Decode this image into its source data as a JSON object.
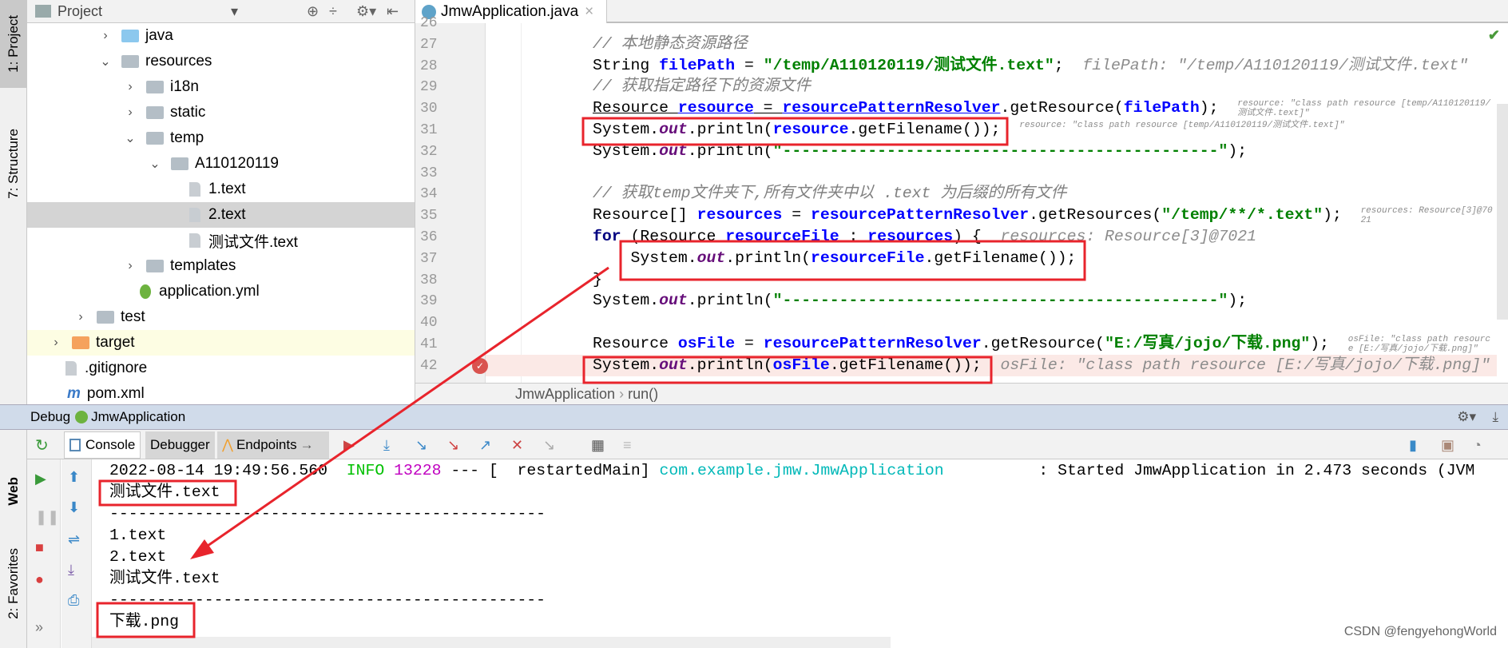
{
  "sidebar_tabs": {
    "project": "1: Project",
    "structure": "7: Structure",
    "web": "Web",
    "favorites": "2: Favorites"
  },
  "project": {
    "title": "Project",
    "tree": [
      {
        "label": "java",
        "depth": 2,
        "icon": "folder-blue",
        "arrow": "right"
      },
      {
        "label": "resources",
        "depth": 2,
        "icon": "resources-folder",
        "arrow": "down"
      },
      {
        "label": "i18n",
        "depth": 3,
        "icon": "folder",
        "arrow": "right"
      },
      {
        "label": "static",
        "depth": 3,
        "icon": "folder",
        "arrow": "right"
      },
      {
        "label": "temp",
        "depth": 3,
        "icon": "folder",
        "arrow": "down"
      },
      {
        "label": "A110120119",
        "depth": 4,
        "icon": "folder",
        "arrow": "down"
      },
      {
        "label": "1.text",
        "depth": 5,
        "icon": "file"
      },
      {
        "label": "2.text",
        "depth": 5,
        "icon": "file",
        "selected": true
      },
      {
        "label": "测试文件.text",
        "depth": 5,
        "icon": "file"
      },
      {
        "label": "templates",
        "depth": 3,
        "icon": "folder",
        "arrow": "right"
      },
      {
        "label": "application.yml",
        "depth": 3,
        "icon": "spring-yml"
      },
      {
        "label": "test",
        "depth": 1,
        "icon": "folder",
        "arrow": "right"
      },
      {
        "label": "target",
        "depth": 0,
        "icon": "folder-orange",
        "arrow": "right",
        "highlight": true
      },
      {
        "label": ".gitignore",
        "depth": 0,
        "icon": "file"
      },
      {
        "label": "pom.xml",
        "depth": 0,
        "icon": "maven"
      }
    ]
  },
  "editor": {
    "tab": "JmwApplication.java",
    "breadcrumb": [
      "JmwApplication",
      "run()"
    ],
    "lines": [
      {
        "n": "26",
        "t": []
      },
      {
        "n": "27",
        "t": [
          [
            "cm",
            "// 本地静态资源路径"
          ]
        ]
      },
      {
        "n": "28",
        "t": [
          [
            "pl",
            "String "
          ],
          [
            "var",
            "filePath"
          ],
          [
            "pl",
            " = "
          ],
          [
            "str",
            "\"/temp/A110120119/测试文件.text\""
          ],
          [
            "pl",
            ";  "
          ],
          [
            "hint",
            "filePath: \"/temp/A110120119/测试文件.text\""
          ]
        ]
      },
      {
        "n": "29",
        "t": [
          [
            "cm",
            "// 获取指定路径下的资源文件"
          ]
        ]
      },
      {
        "n": "30",
        "t": [
          [
            "pl ul",
            "Resource "
          ],
          [
            "var ul",
            "resource"
          ],
          [
            "pl ul",
            " = "
          ],
          [
            "var ul",
            "resourcePatternResolver"
          ],
          [
            "pl",
            ".getResource("
          ],
          [
            "var",
            "filePath"
          ],
          [
            "pl",
            ");  "
          ],
          [
            "hint",
            "resource: \"class path resource [temp/A110120119/测试文件.text]\""
          ]
        ]
      },
      {
        "n": "31",
        "t": [
          [
            "pl",
            "System."
          ],
          [
            "fld",
            "out"
          ],
          [
            "pl",
            ".println("
          ],
          [
            "var",
            "resource"
          ],
          [
            "pl",
            ".getFilename());  "
          ],
          [
            "hint",
            "resource: \"class path resource [temp/A110120119/测试文件.text]\""
          ]
        ]
      },
      {
        "n": "32",
        "t": [
          [
            "pl",
            "System."
          ],
          [
            "fld",
            "out"
          ],
          [
            "pl",
            ".println("
          ],
          [
            "str",
            "\"----------------------------------------------\""
          ],
          [
            "pl",
            ");"
          ]
        ]
      },
      {
        "n": "33",
        "t": []
      },
      {
        "n": "34",
        "t": [
          [
            "cm",
            "// 获取temp文件夹下,所有文件夹中以 .text 为后缀的所有文件"
          ]
        ]
      },
      {
        "n": "35",
        "t": [
          [
            "pl",
            "Resource[] "
          ],
          [
            "var",
            "resources"
          ],
          [
            "pl",
            " = "
          ],
          [
            "var",
            "resourcePatternResolver"
          ],
          [
            "pl",
            ".getResources("
          ],
          [
            "str",
            "\"/temp/**/*.text\""
          ],
          [
            "pl",
            ");  "
          ],
          [
            "hint",
            "resources: Resource[3]@7021"
          ]
        ]
      },
      {
        "n": "36",
        "t": [
          [
            "kw",
            "for"
          ],
          [
            "pl",
            " (Resource "
          ],
          [
            "var",
            "resourceFile"
          ],
          [
            "pl",
            " : "
          ],
          [
            "var",
            "resources"
          ],
          [
            "pl",
            ") {  "
          ],
          [
            "hint",
            "resources: Resource[3]@7021"
          ]
        ]
      },
      {
        "n": "37",
        "t": [
          [
            "pl",
            "    System."
          ],
          [
            "fld",
            "out"
          ],
          [
            "pl",
            ".println("
          ],
          [
            "var",
            "resourceFile"
          ],
          [
            "pl",
            ".getFilename());"
          ]
        ]
      },
      {
        "n": "38",
        "t": [
          [
            "pl",
            "}"
          ]
        ]
      },
      {
        "n": "39",
        "t": [
          [
            "pl",
            "System."
          ],
          [
            "fld",
            "out"
          ],
          [
            "pl",
            ".println("
          ],
          [
            "str",
            "\"----------------------------------------------\""
          ],
          [
            "pl",
            ");"
          ]
        ]
      },
      {
        "n": "40",
        "t": []
      },
      {
        "n": "41",
        "t": [
          [
            "pl",
            "Resource "
          ],
          [
            "var",
            "osFile"
          ],
          [
            "pl",
            " = "
          ],
          [
            "var",
            "resourcePatternResolver"
          ],
          [
            "pl",
            ".getResource("
          ],
          [
            "str",
            "\"E:/写真/jojo/下载.png\""
          ],
          [
            "pl",
            ");  "
          ],
          [
            "hint",
            "osFile: \"class path resource [E:/写真/jojo/下载.png]\""
          ]
        ]
      },
      {
        "n": "42",
        "t": [
          [
            "pl",
            "System."
          ],
          [
            "fld",
            "out"
          ],
          [
            "pl",
            ".println("
          ],
          [
            "var",
            "osFile"
          ],
          [
            "pl",
            ".getFilename());  "
          ],
          [
            "hint",
            "osFile: \"class path resource [E:/写真/jojo/下载.png]\""
          ]
        ],
        "current": true
      }
    ]
  },
  "debug": {
    "label": "Debug",
    "config": "JmwApplication",
    "tabs": [
      "Console",
      "Debugger",
      "Endpoints"
    ]
  },
  "console": {
    "log": {
      "time": "2022-08-14 19:49:56.560",
      "level": "INFO",
      "pid": "13228",
      "sep": " --- [  restartedMain] ",
      "logger": "com.example.jmw.JmwApplication",
      "msg": "          : Started JmwApplication in 2.473 seconds (JVM"
    },
    "lines": [
      "测试文件.text",
      "----------------------------------------------",
      "1.text",
      "2.text",
      "测试文件.text",
      "----------------------------------------------",
      "下载.png"
    ]
  },
  "watermark": "CSDN @fengyehongWorld",
  "colors": {
    "annotation": "#e8242c",
    "selection": "#d4d4d4",
    "current_line": "#fbe9e6",
    "debug_header": "#d0dbea"
  }
}
